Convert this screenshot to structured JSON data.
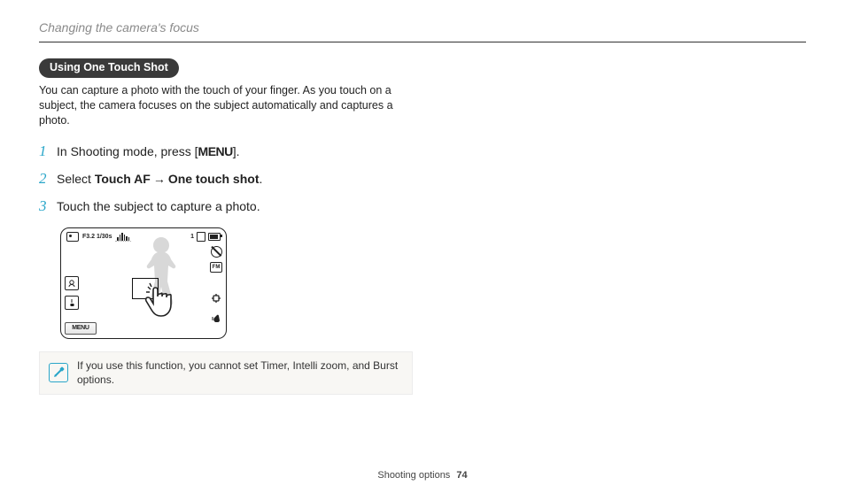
{
  "header": {
    "section_title": "Changing the camera's focus"
  },
  "subsection": {
    "pill": "Using One Touch Shot",
    "intro": "You can capture a photo with the touch of your finger. As you touch on a subject, the camera focuses on the subject automatically and captures a photo."
  },
  "steps": [
    {
      "num": "1",
      "prefix": "In Shooting mode, press [",
      "menu": "MENU",
      "suffix": "]."
    },
    {
      "num": "2",
      "text_a": "Select ",
      "bold_a": "Touch AF",
      "arrow": " → ",
      "bold_b": "One touch shot",
      "text_b": "."
    },
    {
      "num": "3",
      "text": "Touch the subject to capture a photo."
    }
  ],
  "camera": {
    "exposure": "F3.2 1/30s",
    "counter": "1",
    "menu_button": "MENU",
    "fm_label": "FM"
  },
  "note": {
    "text": "If you use this function, you cannot set Timer, Intelli zoom, and Burst options."
  },
  "footer": {
    "label": "Shooting options",
    "page": "74"
  }
}
